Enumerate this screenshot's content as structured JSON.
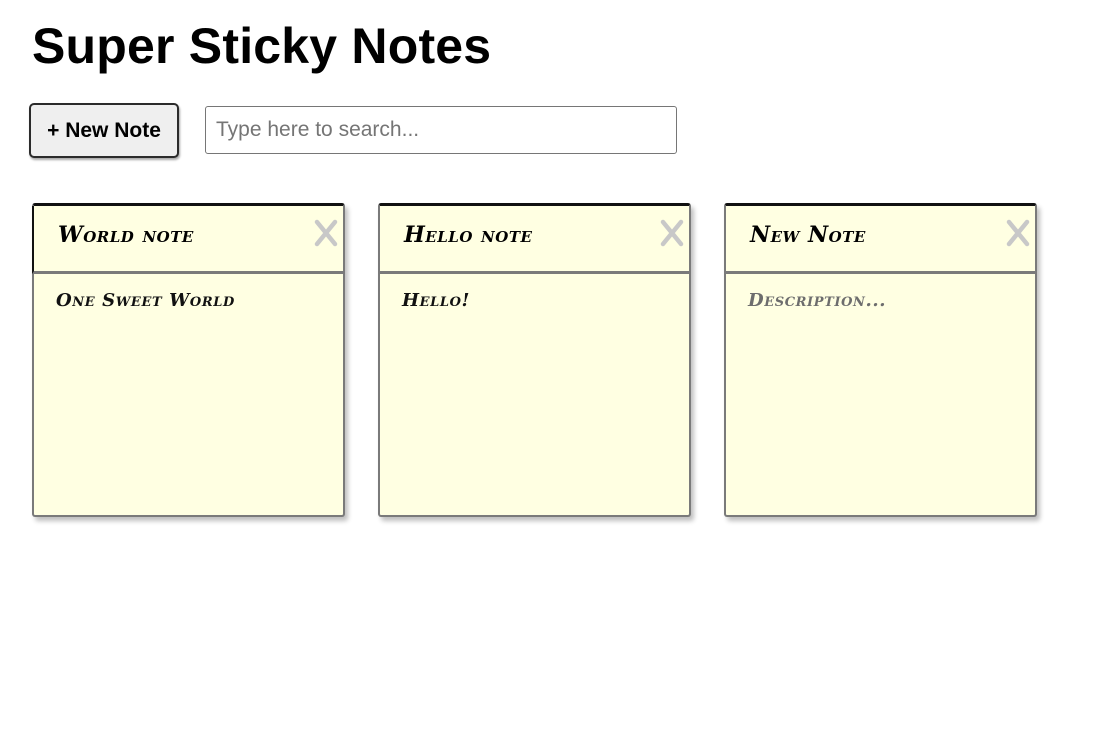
{
  "app": {
    "title": "Super Sticky Notes"
  },
  "toolbar": {
    "new_note_label": "+ New Note",
    "search_placeholder": "Type here to search..."
  },
  "notes": [
    {
      "title": "World note",
      "description": "One Sweet World",
      "description_placeholder": "Description..."
    },
    {
      "title": "Hello note",
      "description": "Hello!",
      "description_placeholder": "Description..."
    },
    {
      "title": "New Note",
      "description": "",
      "description_placeholder": "Description..."
    }
  ],
  "icons": {
    "close": "close-icon"
  },
  "colors": {
    "note_background": "#ffffe2",
    "close_icon": "#c8c8c8"
  }
}
